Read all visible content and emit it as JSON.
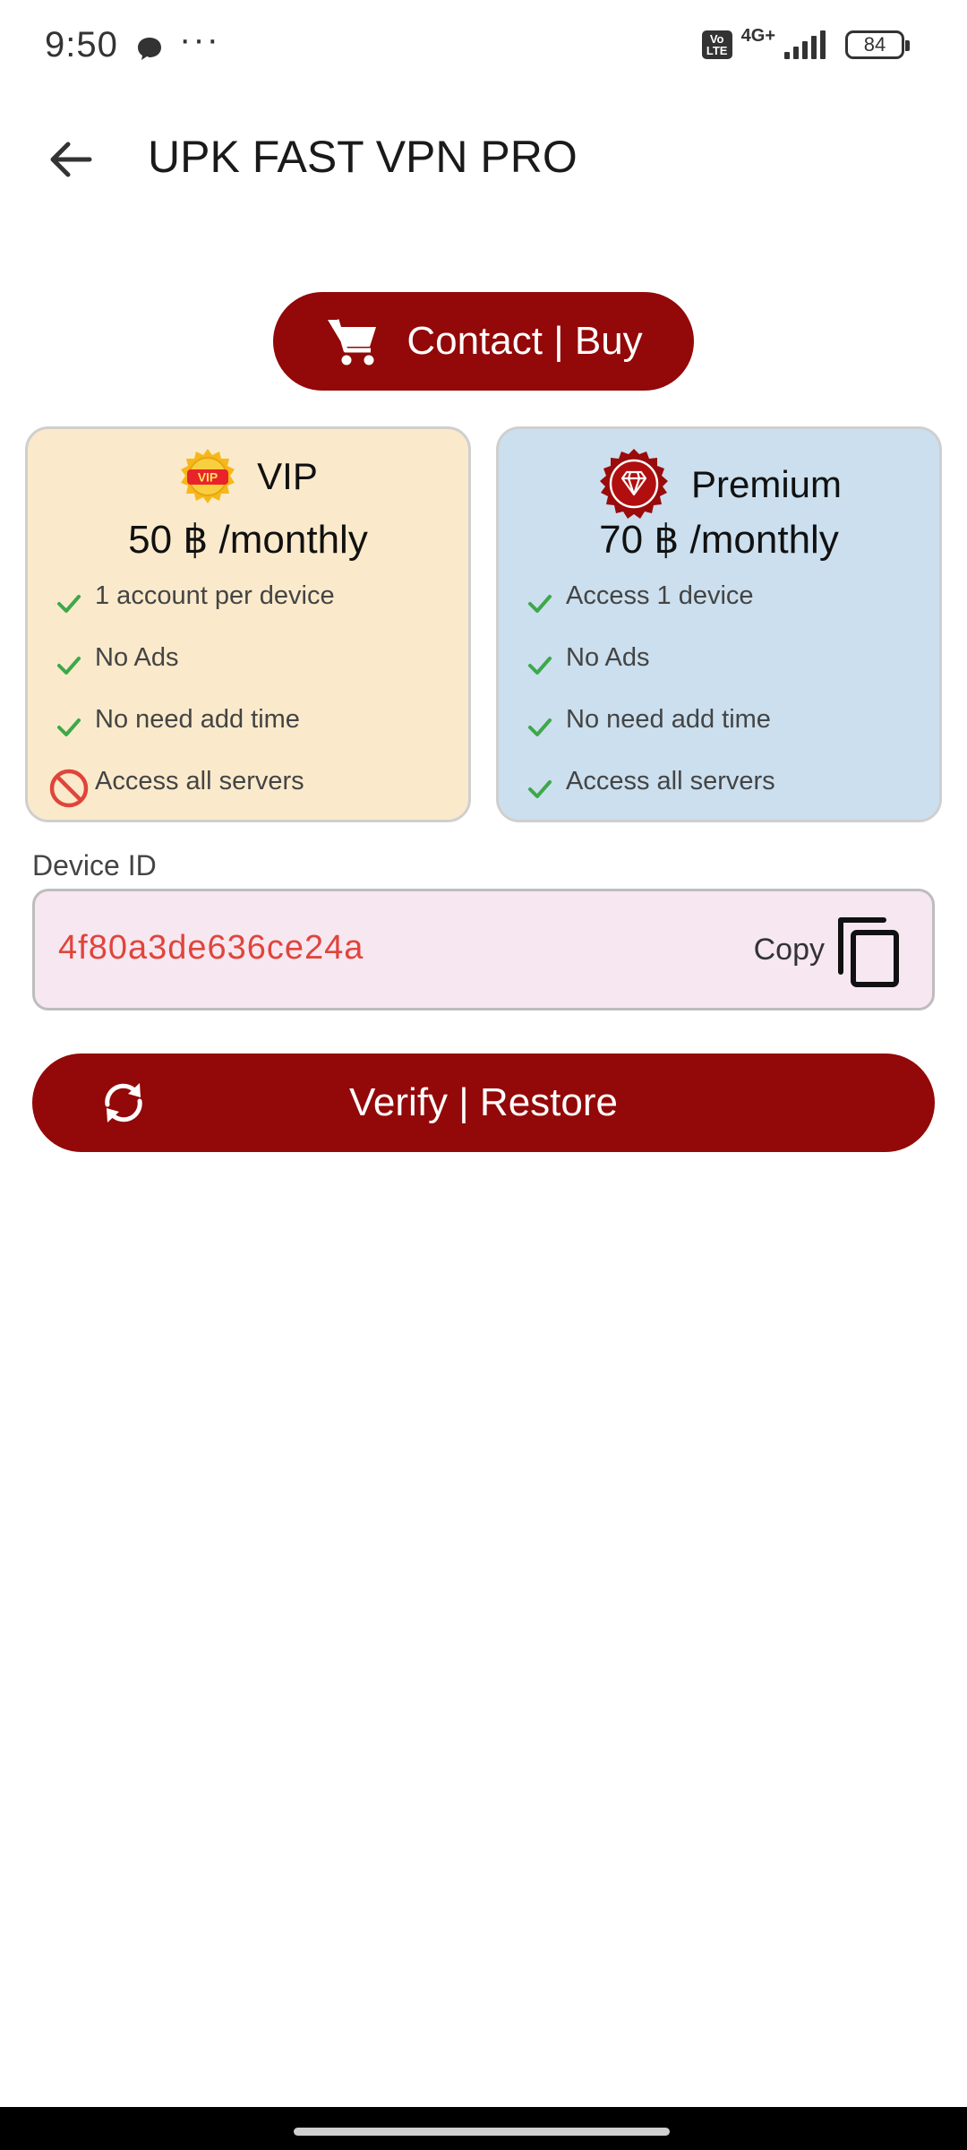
{
  "status_bar": {
    "time": "9:50",
    "more": "···",
    "volte_top": "Vo",
    "volte_bottom": "LTE",
    "network": "4G+",
    "battery": "84"
  },
  "app_bar": {
    "title": "UPK FAST VPN PRO",
    "back_icon": "arrow-back-icon"
  },
  "contact_button": {
    "label": "Contact | Buy",
    "icon": "cart-icon"
  },
  "plans": [
    {
      "name": "VIP",
      "price": "50 ฿ /monthly",
      "badge_text": "VIP",
      "features": [
        {
          "text": "1 account per device",
          "included": true
        },
        {
          "text": "No Ads",
          "included": true
        },
        {
          "text": "No need add time",
          "included": true
        },
        {
          "text": "Access all servers",
          "included": false
        }
      ]
    },
    {
      "name": "Premium",
      "price": "70 ฿ /monthly",
      "features": [
        {
          "text": "Access 1 device",
          "included": true
        },
        {
          "text": "No Ads",
          "included": true
        },
        {
          "text": "No need add time",
          "included": true
        },
        {
          "text": "Access all servers",
          "included": true
        }
      ]
    }
  ],
  "device": {
    "label": "Device ID",
    "id": "4f80a3de636ce24a",
    "copy_label": "Copy"
  },
  "verify_button": {
    "label": "Verify | Restore",
    "icon": "sync-icon"
  },
  "colors": {
    "primary": "#930808",
    "vip_card": "#faeacb",
    "premium_card": "#cbdfee",
    "device_box": "#f7e7f1",
    "device_id_text": "#e0453a",
    "check": "#3ea84a",
    "blocked": "#e0453a"
  }
}
